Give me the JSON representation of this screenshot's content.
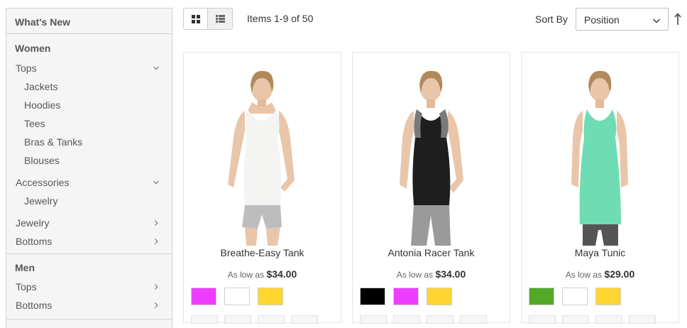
{
  "sidebar": {
    "whats_new": "What's New",
    "women": {
      "title": "Women",
      "tops": "Tops",
      "tops_items": [
        "Jackets",
        "Hoodies",
        "Tees",
        "Bras & Tanks",
        "Blouses"
      ],
      "accessories": "Accessories",
      "accessories_items": [
        "Jewelry"
      ],
      "jewelry": "Jewelry",
      "bottoms": "Bottoms"
    },
    "men": {
      "title": "Men",
      "tops": "Tops",
      "bottoms": "Bottoms"
    }
  },
  "toolbar": {
    "grid_icon": "grid-view-icon",
    "list_icon": "list-view-icon",
    "items_count": "Items 1-9 of 50",
    "sort_label": "Sort By",
    "sort_value": "Position",
    "sort_direction_icon": "sort-ascending-icon"
  },
  "products": [
    {
      "name": "Breathe-Easy Tank",
      "as_low_as": "As low as",
      "price": "$34.00",
      "top_color": "#f4f4f2",
      "trim_color": "#f4f4f2",
      "shorts_color": "#bdbdbd",
      "swatches": [
        "#ef3dff",
        "#ffffff",
        "#ffd531"
      ]
    },
    {
      "name": "Antonia Racer Tank",
      "as_low_as": "As low as",
      "price": "$34.00",
      "top_color": "#1e1e1e",
      "trim_color": "#7a7a7a",
      "shorts_color": "#9a9a9a",
      "swatches": [
        "#000000",
        "#ef3dff",
        "#ffd531"
      ]
    },
    {
      "name": "Maya Tunic",
      "as_low_as": "As low as",
      "price": "$29.00",
      "top_color": "#6fdcb4",
      "trim_color": "#6fdcb4",
      "shorts_color": "#555555",
      "swatches": [
        "#53a828",
        "#ffffff",
        "#ffd531"
      ]
    }
  ]
}
